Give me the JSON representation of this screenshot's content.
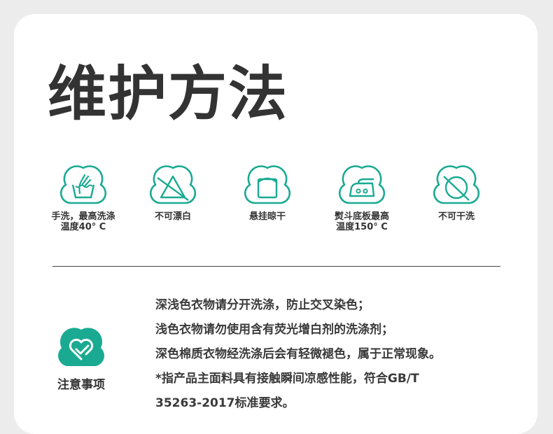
{
  "title": "维护方法",
  "care_icons": [
    {
      "icon": "hand-wash-icon",
      "label": "手洗，最高洗涤\n温度40° C"
    },
    {
      "icon": "no-bleach-icon",
      "label": "不可漂白"
    },
    {
      "icon": "hang-dry-icon",
      "label": "悬挂晾干"
    },
    {
      "icon": "iron-medium-icon",
      "label": "熨斗底板最高\n温度150° C"
    },
    {
      "icon": "no-tumble-dry-icon",
      "label": "不可干洗"
    }
  ],
  "notice": {
    "icon": "heart-check-icon",
    "label": "注意事项",
    "lines": [
      "深浅色衣物请分开洗涤，防止交叉染色；",
      "浅色衣物请勿使用含有荧光增白剂的洗涤剂；",
      "深色棉质衣物经洗涤后会有轻微褪色，属于正常现象。",
      "*指产品主面料具有接触瞬间凉感性能，符合GB/T",
      "35263-2017标准要求。"
    ]
  },
  "colors": {
    "accent": "#1aaa92",
    "text": "#333333",
    "background": "#ececec",
    "card": "#ffffff"
  }
}
